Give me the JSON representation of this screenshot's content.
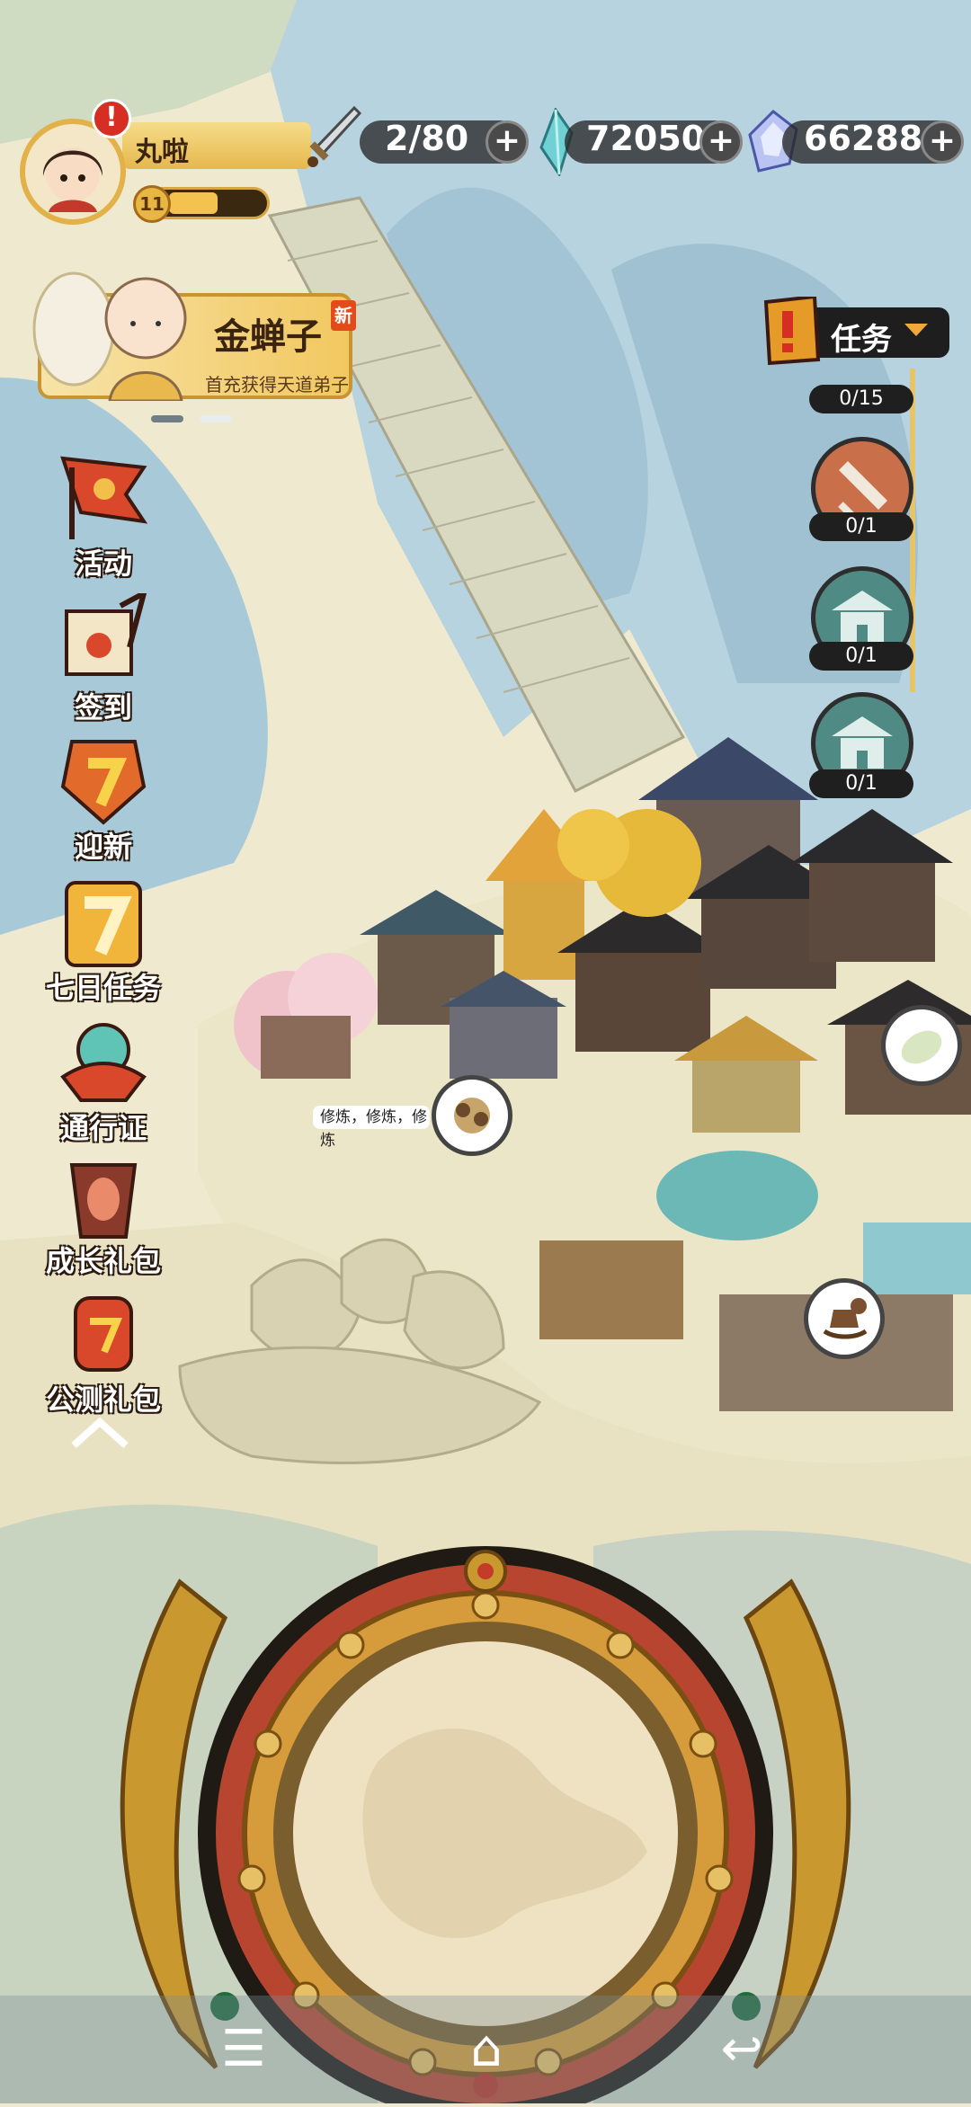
{
  "player": {
    "name": "丸啦",
    "level": "11",
    "alert_badge": "!",
    "level_progress_fraction": 0.5
  },
  "resources": {
    "stamina": "2/80",
    "jade": "720506",
    "gems": "66288",
    "add_symbol": "+"
  },
  "promo": {
    "name": "金蝉子",
    "tag": "新",
    "subtitle": "首充获得天道弟子"
  },
  "menu": {
    "items": [
      {
        "label": "活动",
        "icon": "banner-flag-icon"
      },
      {
        "label": "签到",
        "icon": "scroll-brush-icon"
      },
      {
        "label": "迎新",
        "icon": "seven-badge-icon"
      },
      {
        "label": "七日任务",
        "icon": "seven-day-icon"
      },
      {
        "label": "通行证",
        "icon": "orb-pass-icon"
      },
      {
        "label": "成长礼包",
        "icon": "vase-gift-icon"
      },
      {
        "label": "公测礼包",
        "icon": "lantern-gift-icon"
      }
    ]
  },
  "tasks": {
    "label": "任务",
    "counters": [
      "0/15",
      "0/1",
      "0/1",
      "0/1"
    ],
    "icons": [
      "task-flag-icon",
      "sword-icon",
      "pavilion-icon",
      "pavilion-icon"
    ]
  },
  "scene": {
    "chat_text": "修炼，修炼，修炼",
    "bubbles": [
      "sword-bundle-icon",
      "rice-ball-icon",
      "rocking-horse-icon"
    ]
  },
  "nav": {
    "menu_symbol": "☰",
    "home_symbol": "⌂",
    "back_symbol": "↩"
  },
  "colors": {
    "sky": "#efe9cf",
    "mountain": "#a9cbdb",
    "gold": "#e3b14a",
    "alert_red": "#d62e22"
  }
}
